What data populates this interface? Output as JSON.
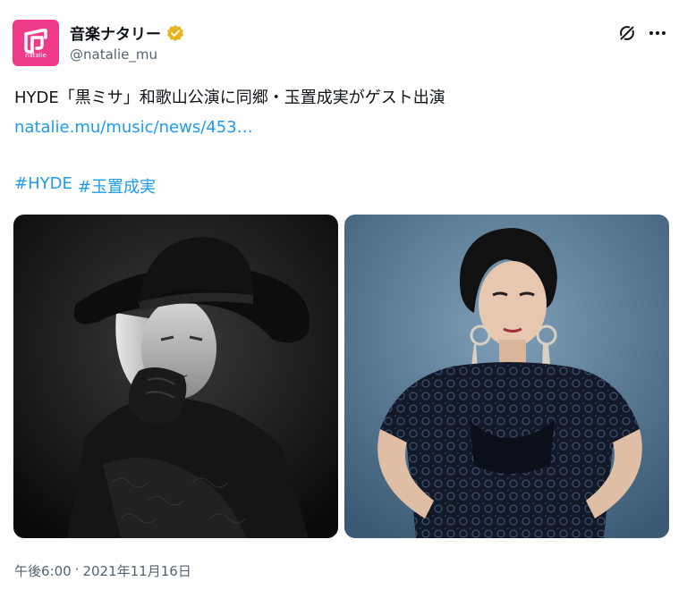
{
  "account": {
    "display_name": "音楽ナタリー",
    "handle": "@natalie_mu",
    "avatar_text": "natalie",
    "verified_color": "#e8b520"
  },
  "tweet": {
    "text": "HYDE「黒ミサ」和歌山公演に同郷・玉置成実がゲスト出演",
    "link": "natalie.mu/music/news/453…",
    "hashtags": [
      "#HYDE",
      "#玉置成実"
    ]
  },
  "media": [
    {
      "subject": "black-and-white portrait with wide-brim hat"
    },
    {
      "subject": "portrait in black lace dress on blue background"
    }
  ],
  "meta": {
    "time": "午後6:00",
    "separator": "·",
    "date": "2021年11月16日"
  },
  "colors": {
    "link": "#1d9bf0",
    "brand": "#f03b8a",
    "secondary_text": "#536471"
  }
}
